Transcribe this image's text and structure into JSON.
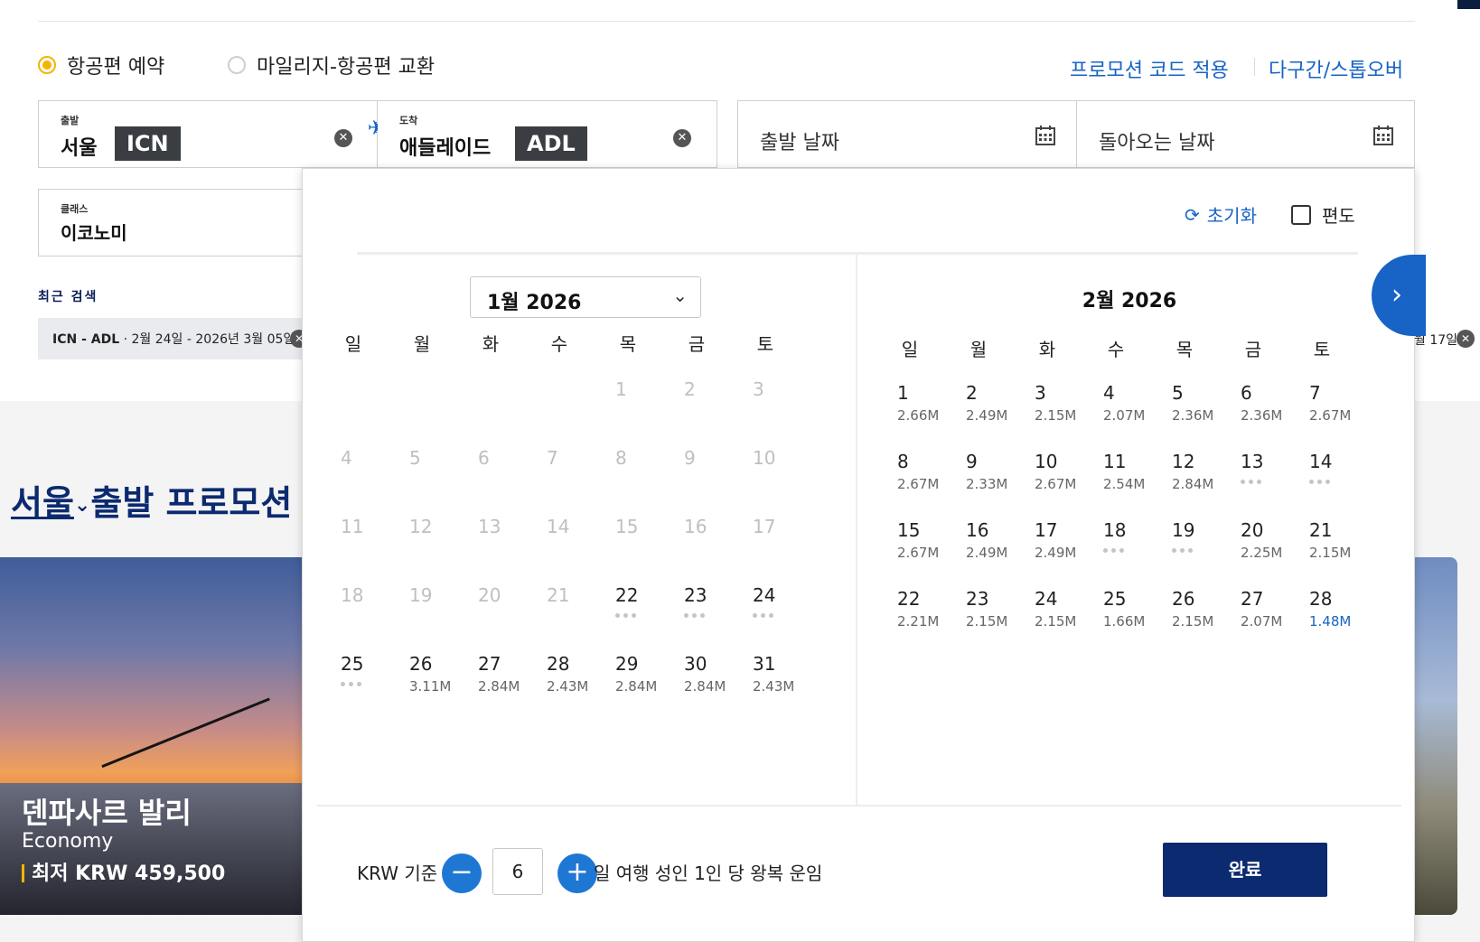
{
  "colors": {
    "accent": "#1763c6",
    "navy": "#0b2a6f",
    "radio_on": "#f5b400",
    "price_low": "#1763c6"
  },
  "booking_type": {
    "options": [
      {
        "label": "항공편 예약",
        "selected": true
      },
      {
        "label": "마일리지-항공편 교환",
        "selected": false
      }
    ]
  },
  "links": {
    "promo_code": "프로모션 코드 적용",
    "multi_city": "다구간/스톱오버"
  },
  "origin": {
    "label": "출발",
    "city": "서울",
    "code": "ICN"
  },
  "destination": {
    "label": "도착",
    "city": "애들레이드",
    "code": "ADL"
  },
  "depart_date": {
    "placeholder": "출발 날짜",
    "icon": "calendar-icon"
  },
  "return_date": {
    "placeholder": "돌아오는 날짜",
    "icon": "calendar-icon"
  },
  "cabin": {
    "label": "클래스",
    "value": "이코노미"
  },
  "recent": {
    "title": "최근 검색",
    "item_route": "ICN - ADL",
    "item_dates": " · 2월 24일 - 2026년 3월 05일",
    "right_chip_text": "월 17일"
  },
  "promo": {
    "city": "서울",
    "heading_rest": "출발 프로모션",
    "card": {
      "destination": "덴파사르 발리",
      "cabin": "Economy",
      "price": "최저 KRW 459,500"
    }
  },
  "datepicker": {
    "reset_label": "초기화",
    "oneway_label": "편도",
    "weekdays": [
      "일",
      "월",
      "화",
      "수",
      "목",
      "금",
      "토"
    ],
    "month1": {
      "title": "1월 2026",
      "weeks": [
        [
          null,
          null,
          null,
          null,
          {
            "d": "1",
            "dis": true
          },
          {
            "d": "2",
            "dis": true
          },
          {
            "d": "3",
            "dis": true
          }
        ],
        [
          {
            "d": "4",
            "dis": true
          },
          {
            "d": "5",
            "dis": true
          },
          {
            "d": "6",
            "dis": true
          },
          {
            "d": "7",
            "dis": true
          },
          {
            "d": "8",
            "dis": true
          },
          {
            "d": "9",
            "dis": true
          },
          {
            "d": "10",
            "dis": true
          }
        ],
        [
          {
            "d": "11",
            "dis": true
          },
          {
            "d": "12",
            "dis": true
          },
          {
            "d": "13",
            "dis": true
          },
          {
            "d": "14",
            "dis": true
          },
          {
            "d": "15",
            "dis": true
          },
          {
            "d": "16",
            "dis": true
          },
          {
            "d": "17",
            "dis": true
          }
        ],
        [
          {
            "d": "18",
            "dis": true
          },
          {
            "d": "19",
            "dis": true
          },
          {
            "d": "20",
            "dis": true
          },
          {
            "d": "21",
            "dis": true
          },
          {
            "d": "22",
            "dots": true
          },
          {
            "d": "23",
            "dots": true
          },
          {
            "d": "24",
            "dots": true
          }
        ],
        [
          {
            "d": "25",
            "dots": true
          },
          {
            "d": "26",
            "p": "3.11M"
          },
          {
            "d": "27",
            "p": "2.84M"
          },
          {
            "d": "28",
            "p": "2.43M"
          },
          {
            "d": "29",
            "p": "2.84M"
          },
          {
            "d": "30",
            "p": "2.84M"
          },
          {
            "d": "31",
            "p": "2.43M"
          }
        ]
      ]
    },
    "month2": {
      "title": "2월 2026",
      "weeks": [
        [
          {
            "d": "1",
            "p": "2.66M"
          },
          {
            "d": "2",
            "p": "2.49M"
          },
          {
            "d": "3",
            "p": "2.15M"
          },
          {
            "d": "4",
            "p": "2.07M"
          },
          {
            "d": "5",
            "p": "2.36M"
          },
          {
            "d": "6",
            "p": "2.36M"
          },
          {
            "d": "7",
            "p": "2.67M"
          }
        ],
        [
          {
            "d": "8",
            "p": "2.67M"
          },
          {
            "d": "9",
            "p": "2.33M"
          },
          {
            "d": "10",
            "p": "2.67M"
          },
          {
            "d": "11",
            "p": "2.54M"
          },
          {
            "d": "12",
            "p": "2.84M"
          },
          {
            "d": "13",
            "dots": true
          },
          {
            "d": "14",
            "dots": true
          }
        ],
        [
          {
            "d": "15",
            "p": "2.67M"
          },
          {
            "d": "16",
            "p": "2.49M"
          },
          {
            "d": "17",
            "p": "2.49M"
          },
          {
            "d": "18",
            "dots": true
          },
          {
            "d": "19",
            "dots": true
          },
          {
            "d": "20",
            "p": "2.25M"
          },
          {
            "d": "21",
            "p": "2.15M"
          }
        ],
        [
          {
            "d": "22",
            "p": "2.21M"
          },
          {
            "d": "23",
            "p": "2.15M"
          },
          {
            "d": "24",
            "p": "2.15M"
          },
          {
            "d": "25",
            "p": "1.66M"
          },
          {
            "d": "26",
            "p": "2.15M"
          },
          {
            "d": "27",
            "p": "2.07M"
          },
          {
            "d": "28",
            "p": "1.48M",
            "low": true
          }
        ]
      ]
    },
    "footer": {
      "currency_label": "KRW 기준",
      "trip_days": "6",
      "trip_suffix": "일 여행 성인 1인 당 왕복 운임",
      "done_label": "완료"
    }
  }
}
